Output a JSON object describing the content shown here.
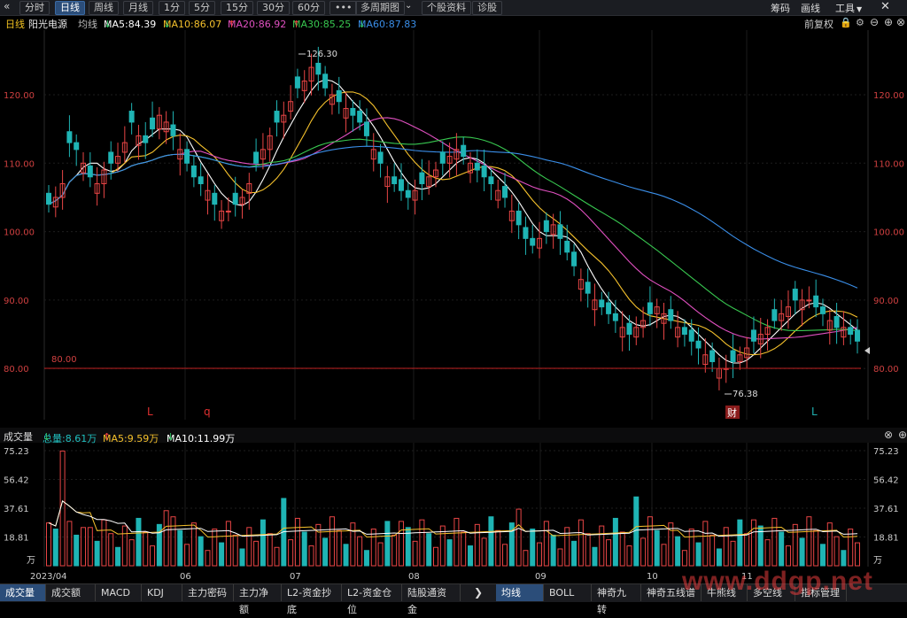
{
  "nav": {
    "back_icon": "double-chevron-left-icon",
    "tabs": [
      "分时",
      "日线",
      "周线",
      "月线",
      "1分",
      "5分",
      "15分",
      "30分",
      "60分",
      "•••",
      "多周期图",
      "个股资料",
      "诊股"
    ],
    "active_tab": "日线",
    "multi_period_caret": "⌄",
    "right": {
      "code_label": "筹码",
      "draw_label": "画线",
      "tools_label": "工具"
    }
  },
  "legend": {
    "period": "日线",
    "stock_name": "阳光电源",
    "ma_title": "均线",
    "ma5": "MA5:84.39",
    "ma10": "MA10:86.07",
    "ma20": "MA20:86.92",
    "ma30": "MA30:85.25",
    "ma60": "MA60:87.83",
    "adjust": "前复权",
    "colors": {
      "ma5": "#ffffff",
      "ma10": "#f5c12c",
      "ma20": "#e050c0",
      "ma30": "#38c850",
      "ma60": "#3a8ee8"
    }
  },
  "main_chart": {
    "y_ticks": [
      "120.00",
      "110.00",
      "100.00",
      "90.00",
      "80.00"
    ],
    "x_ticks": [
      "06",
      "07",
      "08",
      "09",
      "10",
      "11"
    ],
    "high_label": "126.30",
    "low_label": "76.38",
    "ref_line_label": "80.00",
    "marks": {
      "l1": "L",
      "q": "q",
      "cai": "财",
      "l2": "L"
    }
  },
  "volume": {
    "title": "成交量",
    "total": "总量:8.61万",
    "ma5": "MA5:9.59万",
    "ma10": "MA10:11.99万",
    "y_ticks": [
      "75.23",
      "56.42",
      "37.61",
      "18.81",
      "万"
    ],
    "x_ticks": [
      "2023/04",
      "06",
      "07",
      "08",
      "09",
      "10",
      "11"
    ]
  },
  "bottom_tabs": {
    "left": [
      "成交量",
      "成交额",
      "MACD",
      "KDJ",
      "主力密码",
      "主力净额",
      "L2-资金抄底",
      "L2-资金仓位",
      "陆股通资金"
    ],
    "active_left": "成交量",
    "right": [
      "均线",
      "BOLL",
      "神奇九转",
      "神奇五线谱",
      "牛熊线",
      "多空线",
      "指标管理"
    ],
    "active_right": "均线"
  },
  "watermark": "www.ddgp.net",
  "chart_data": [
    {
      "type": "candlestick",
      "title": "阳光电源 日线",
      "ylim": [
        75,
        130
      ],
      "x_ticks": [
        "06",
        "07",
        "08",
        "09",
        "10",
        "11"
      ],
      "high": 126.3,
      "low": 76.38,
      "reference_line": 80.0,
      "close_series": [
        104,
        105,
        107,
        113,
        112,
        110,
        108,
        107,
        109,
        110,
        111,
        113,
        116,
        114,
        113,
        115,
        117,
        116,
        114,
        112,
        110,
        108,
        107,
        106,
        104,
        103,
        103,
        104,
        105,
        107,
        110,
        112,
        114,
        116,
        117,
        119,
        121,
        122,
        124,
        123,
        121,
        120,
        119,
        118,
        117,
        116,
        114,
        112,
        110,
        108,
        107,
        106,
        105,
        106,
        107,
        108,
        109,
        110,
        111,
        112,
        111,
        110,
        109,
        108,
        107,
        106,
        105,
        103,
        101,
        99,
        98,
        99,
        100,
        101,
        99,
        97,
        95,
        93,
        91,
        90,
        89,
        88,
        87,
        86,
        85,
        86,
        87,
        88,
        89,
        88,
        87,
        86,
        85,
        84,
        83,
        82,
        81,
        80,
        80,
        81,
        82,
        83,
        84,
        85,
        86,
        87,
        88,
        89,
        90,
        90,
        90,
        89,
        88,
        87,
        86,
        86,
        85,
        84
      ]
    },
    {
      "type": "bar",
      "title": "成交量",
      "unit": "万",
      "ylim": [
        0,
        75.23
      ],
      "y_ticks": [
        18.81,
        37.61,
        56.42,
        75.23
      ],
      "total": 8.61,
      "ma5": 9.59,
      "ma10": 11.99
    }
  ]
}
